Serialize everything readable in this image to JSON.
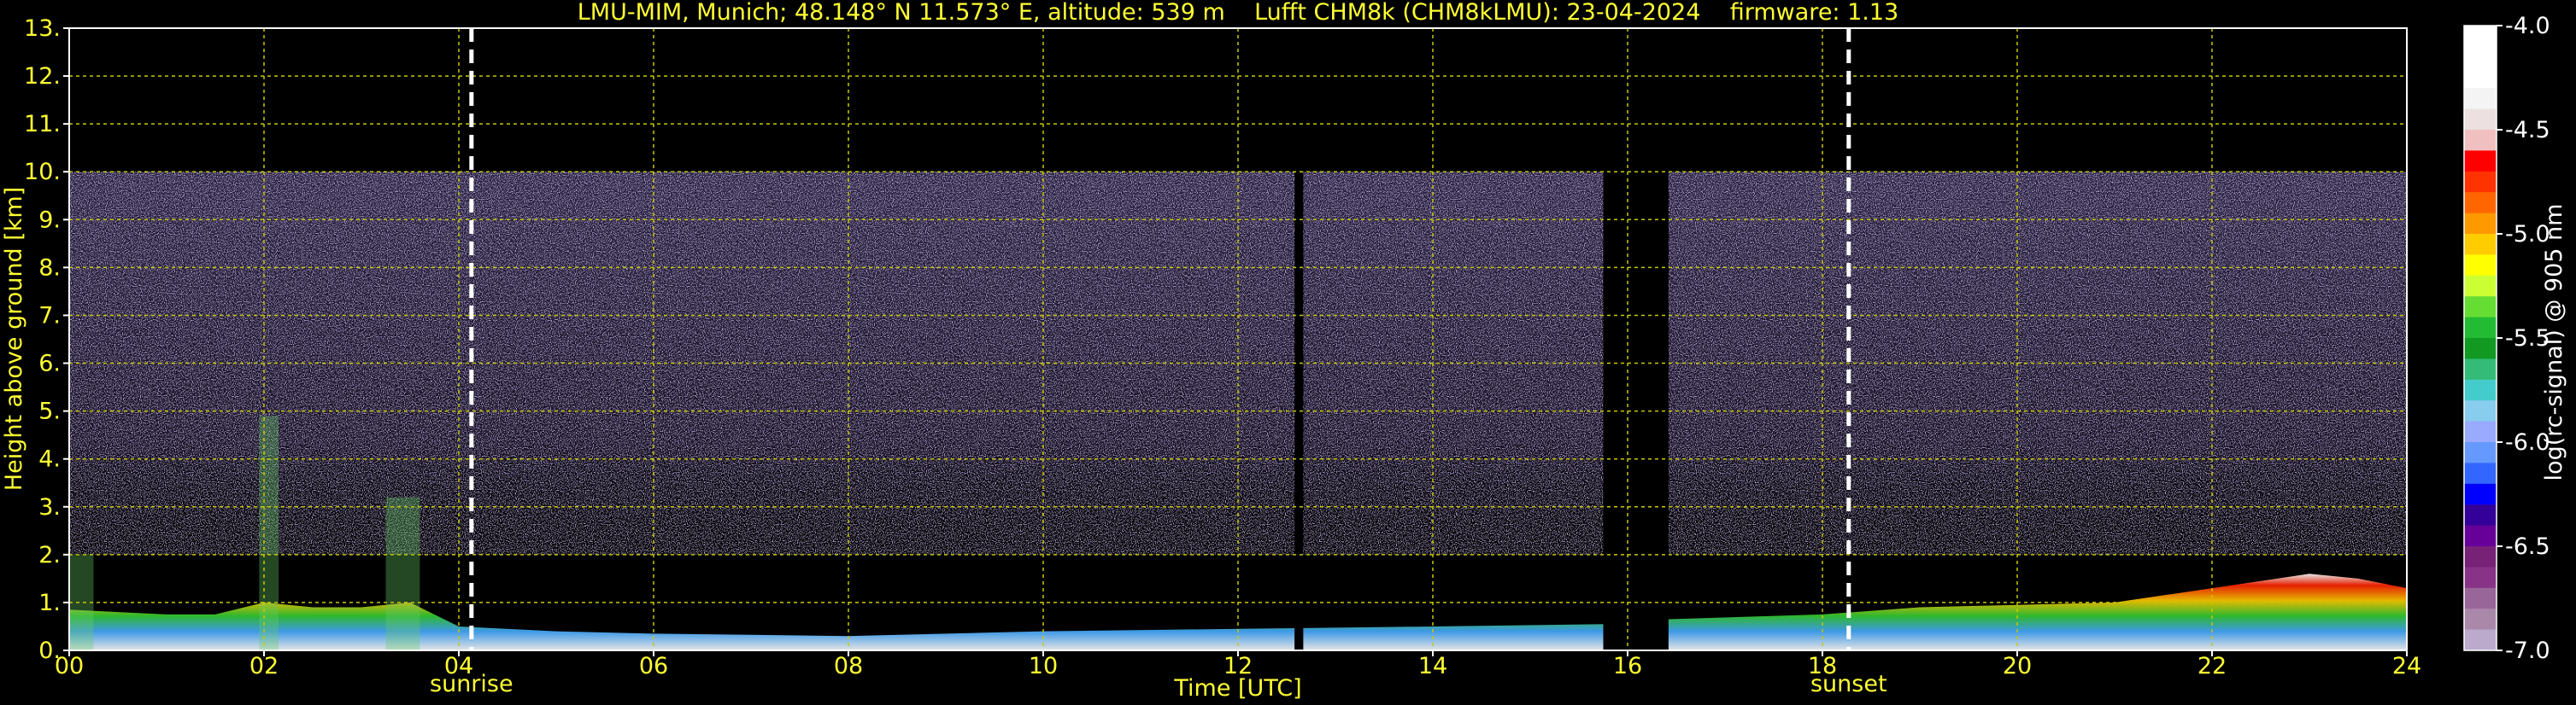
{
  "chart_data": {
    "type": "heatmap",
    "title": "LMU-MIM, Munich; 48.148° N 11.573° E, altitude: 539 m    Lufft CHM8k (CHM8kLMU): 23-04-2024    firmware: 1.13",
    "xlabel": "Time [UTC]",
    "ylabel": "Height above ground [km]",
    "xlim": [
      0,
      24
    ],
    "ylim": [
      0,
      13
    ],
    "x_ticks": [
      "00",
      "02",
      "04",
      "06",
      "08",
      "10",
      "12",
      "14",
      "16",
      "18",
      "20",
      "22",
      "24"
    ],
    "y_ticks": [
      "0.",
      "1.",
      "2.",
      "3.",
      "4.",
      "5.",
      "6.",
      "7.",
      "8.",
      "9.",
      "10.",
      "11.",
      "12.",
      "13."
    ],
    "grid": true,
    "grid_color": "#c8c800",
    "data_top_km": 10,
    "events": [
      {
        "label": "sunrise",
        "time_utc": 4.13
      },
      {
        "label": "sunset",
        "time_utc": 18.27
      }
    ],
    "data_gaps_utc": [
      [
        12.58,
        12.67
      ],
      [
        15.75,
        16.42
      ]
    ],
    "boundary_layer": [
      {
        "t": 0.0,
        "h": 0.85
      },
      {
        "t": 0.5,
        "h": 0.8
      },
      {
        "t": 1.0,
        "h": 0.75
      },
      {
        "t": 1.5,
        "h": 0.75
      },
      {
        "t": 2.0,
        "h": 1.0
      },
      {
        "t": 2.5,
        "h": 0.9
      },
      {
        "t": 3.0,
        "h": 0.9
      },
      {
        "t": 3.5,
        "h": 1.0
      },
      {
        "t": 4.0,
        "h": 0.5
      },
      {
        "t": 5.0,
        "h": 0.4
      },
      {
        "t": 6.0,
        "h": 0.35
      },
      {
        "t": 8.0,
        "h": 0.3
      },
      {
        "t": 10.0,
        "h": 0.4
      },
      {
        "t": 12.0,
        "h": 0.45
      },
      {
        "t": 14.0,
        "h": 0.5
      },
      {
        "t": 15.75,
        "h": 0.55
      },
      {
        "t": 16.42,
        "h": 0.65
      },
      {
        "t": 18.0,
        "h": 0.75
      },
      {
        "t": 19.0,
        "h": 0.9
      },
      {
        "t": 20.0,
        "h": 0.95
      },
      {
        "t": 21.0,
        "h": 1.0
      },
      {
        "t": 22.0,
        "h": 1.3
      },
      {
        "t": 23.0,
        "h": 1.6
      },
      {
        "t": 23.5,
        "h": 1.5
      },
      {
        "t": 24.0,
        "h": 1.3
      }
    ],
    "plumes": [
      {
        "t_start": 0.0,
        "t_end": 0.25,
        "top": 2.0
      },
      {
        "t_start": 1.95,
        "t_end": 2.15,
        "top": 4.9
      },
      {
        "t_start": 3.25,
        "t_end": 3.6,
        "top": 3.2
      }
    ],
    "colorbar": {
      "label": "log(rc-signal) @ 905 nm",
      "range": [
        -7.0,
        -4.0
      ],
      "ticks": [
        "-4.0",
        "-4.5",
        "-5.0",
        "-5.5",
        "-6.0",
        "-6.5",
        "-7.0"
      ],
      "colors": [
        "#ffffff",
        "#ffffff",
        "#ffffff",
        "#f4f4f4",
        "#ece0e0",
        "#f0c0c0",
        "#ff0000",
        "#ff3300",
        "#ff6600",
        "#ff9900",
        "#ffcc00",
        "#ffff00",
        "#ccff33",
        "#66dd33",
        "#22bb33",
        "#119922",
        "#33bb77",
        "#44cccc",
        "#88ccee",
        "#99aaff",
        "#6699ff",
        "#3366ff",
        "#0000ff",
        "#330099",
        "#660099",
        "#772277",
        "#883388",
        "#996699",
        "#aa88aa",
        "#bbaacc"
      ]
    }
  }
}
